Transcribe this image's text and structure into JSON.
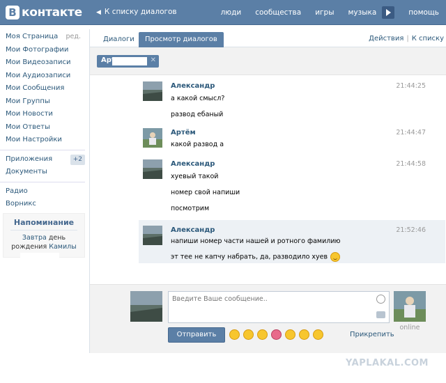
{
  "header": {
    "logo_letter": "В",
    "logo_text": "контакте",
    "back_link": "К списку диалогов",
    "nav": [
      "люди",
      "сообщества",
      "игры",
      "музыка",
      "помощь"
    ]
  },
  "sidebar": {
    "items": [
      {
        "label": "Моя Страница",
        "extra": "ред."
      },
      {
        "label": "Мои Фотографии"
      },
      {
        "label": "Мои Видеозаписи"
      },
      {
        "label": "Мои Аудиозаписи"
      },
      {
        "label": "Мои Сообщения"
      },
      {
        "label": "Мои Группы"
      },
      {
        "label": "Мои Новости"
      },
      {
        "label": "Мои Ответы"
      },
      {
        "label": "Мои Настройки"
      }
    ],
    "apps": {
      "label": "Приложения",
      "badge": "+2"
    },
    "documents": "Документы",
    "radio": "Радио",
    "vorniks": "Ворникс",
    "reminder": {
      "title": "Напоминание",
      "line1_link": "Завтра",
      "line1_rest": " день",
      "line2_rest": "рождения ",
      "line2_link": "Камилы"
    }
  },
  "tabs": {
    "dialogs": "Диалоги",
    "view": "Просмотр диалогов",
    "actions": "Действия",
    "to_list": "К списку"
  },
  "filter": {
    "chip_name": "Арт",
    "chip_close": "✕"
  },
  "messages": [
    {
      "author": "Александр",
      "time": "21:44:25",
      "lines": [
        "а какой смысл?",
        "развод ебаный"
      ]
    },
    {
      "author": "Артём",
      "time": "21:44:47",
      "lines": [
        "какой развод а"
      ]
    },
    {
      "author": "Александр",
      "time": "21:44:58",
      "lines": [
        "хуевый такой",
        "номер свой напиши",
        "посмотрим"
      ]
    },
    {
      "author": "Александр",
      "time": "21:52:46",
      "lines": [
        "напиши номер части нашей и ротного фамилию",
        "эт тее не капчу набрать, да, разводило хуев"
      ]
    }
  ],
  "composer": {
    "placeholder": "Введите Ваше сообщение..",
    "online": "online",
    "send": "Отправить",
    "attach": "Прикрепить"
  },
  "watermark": "YAPLAKAL.COM",
  "colors": {
    "brand": "#5b7fa6",
    "link": "#2b587a",
    "highlight": "#edf1f5"
  }
}
